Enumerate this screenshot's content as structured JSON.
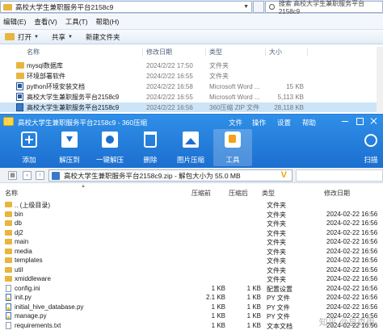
{
  "explorer": {
    "path": "高校大学生兼职服务平台2158c9",
    "search_placeholder": "搜索 高校大学生兼职服务平台2158c9",
    "menu": [
      "编辑(E)",
      "查看(V)",
      "工具(T)",
      "帮助(H)"
    ],
    "toolbar": {
      "open": "打开",
      "share": "共享",
      "new_folder": "新建文件夹"
    },
    "columns": {
      "name": "名称",
      "date": "修改日期",
      "type": "类型",
      "size": "大小"
    },
    "rows": [
      {
        "icon": "folder-icon",
        "name": "mysql数据库",
        "date": "2024/2/22 17:50",
        "type": "文件夹",
        "size": ""
      },
      {
        "icon": "folder-icon",
        "name": "环境部署软件",
        "date": "2024/2/22 16:55",
        "type": "文件夹",
        "size": ""
      },
      {
        "icon": "word-doc-icon",
        "name": "python环境安装文档",
        "date": "2024/2/22 16:58",
        "type": "Microsoft Word ...",
        "size": "15 KB"
      },
      {
        "icon": "word-doc-icon",
        "name": "高校大学生兼职服务平台2158c9",
        "date": "2024/2/22 16:55",
        "type": "Microsoft Word ...",
        "size": "5,113 KB"
      },
      {
        "icon": "zip-archive-icon",
        "name": "高校大学生兼职服务平台2158c9",
        "date": "2024/2/22 16:56",
        "type": "360压缩 ZIP 文件",
        "size": "28,118 KB",
        "selected": true
      }
    ]
  },
  "zip": {
    "title": "高校大学生兼职服务平台2158c9 - 360压缩",
    "menu": {
      "file": "文件",
      "ops": "操作",
      "tools": "工具",
      "settings": "设置",
      "help": "帮助"
    },
    "tools": {
      "add": "添加",
      "extract_to": "解压到",
      "one_click_extract": "一键解压",
      "delete": "删除",
      "image_zip": "图片压缩",
      "tools": "工具"
    },
    "scan": "扫描",
    "address": "高校大学生兼职服务平台2158c9.zip - 解包大小为 55.0 MB",
    "columns": {
      "name": "名称",
      "compressed": "压缩前",
      "after": "压缩后",
      "type": "类型",
      "date": "修改日期"
    },
    "rows": [
      {
        "icon": "folder-icon",
        "name": ".. (上级目录)",
        "size": "",
        "comp": "",
        "type": "文件夹",
        "date": ""
      },
      {
        "icon": "folder-icon",
        "name": "bin",
        "size": "",
        "comp": "",
        "type": "文件夹",
        "date": "2024-02-22 16:56"
      },
      {
        "icon": "folder-icon",
        "name": "db",
        "size": "",
        "comp": "",
        "type": "文件夹",
        "date": "2024-02-22 16:56"
      },
      {
        "icon": "folder-icon",
        "name": "dj2",
        "size": "",
        "comp": "",
        "type": "文件夹",
        "date": "2024-02-22 16:56"
      },
      {
        "icon": "folder-icon",
        "name": "main",
        "size": "",
        "comp": "",
        "type": "文件夹",
        "date": "2024-02-22 16:56"
      },
      {
        "icon": "folder-icon",
        "name": "media",
        "size": "",
        "comp": "",
        "type": "文件夹",
        "date": "2024-02-22 16:56"
      },
      {
        "icon": "folder-icon",
        "name": "templates",
        "size": "",
        "comp": "",
        "type": "文件夹",
        "date": "2024-02-22 16:56"
      },
      {
        "icon": "folder-icon",
        "name": "util",
        "size": "",
        "comp": "",
        "type": "文件夹",
        "date": "2024-02-22 16:56"
      },
      {
        "icon": "folder-icon",
        "name": "xmiddleware",
        "size": "",
        "comp": "",
        "type": "文件夹",
        "date": "2024-02-22 16:56"
      },
      {
        "icon": "file-icon",
        "name": "config.ini",
        "size": "1 KB",
        "comp": "1 KB",
        "type": "配置设置",
        "date": "2024-02-22 16:56"
      },
      {
        "icon": "python-file-icon",
        "name": "init.py",
        "size": "2.1 KB",
        "comp": "1 KB",
        "type": "PY 文件",
        "date": "2024-02-22 16:56"
      },
      {
        "icon": "python-file-icon",
        "name": "initial_hive_database.py",
        "size": "1 KB",
        "comp": "1 KB",
        "type": "PY 文件",
        "date": "2024-02-22 16:56"
      },
      {
        "icon": "python-file-icon",
        "name": "manage.py",
        "size": "1 KB",
        "comp": "1 KB",
        "type": "PY 文件",
        "date": "2024-02-22 16:56"
      },
      {
        "icon": "file-icon",
        "name": "requirements.txt",
        "size": "1 KB",
        "comp": "1 KB",
        "type": "文本文档",
        "date": "2024-02-22 16:56"
      }
    ]
  },
  "watermark": "知乎 @皇森雨"
}
